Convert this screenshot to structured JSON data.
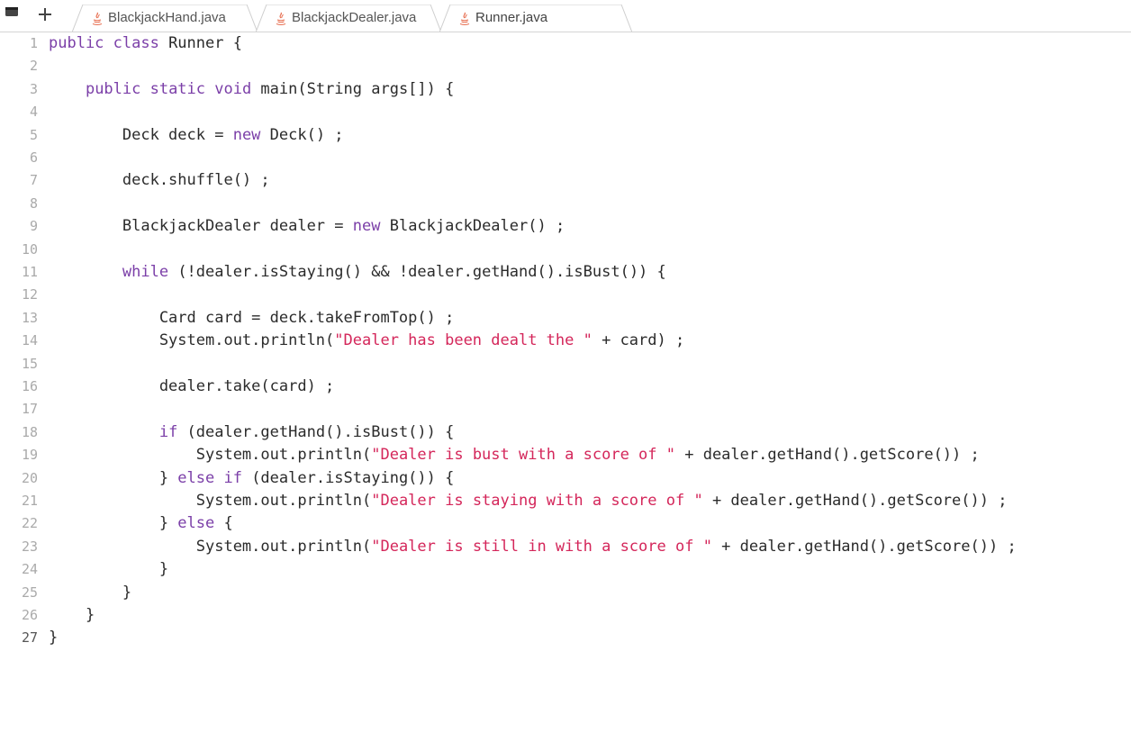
{
  "colors": {
    "keyword": "#7b3fa8",
    "string": "#d4265a",
    "plain": "#2b2b2b",
    "line_number": "#aaaaaa",
    "java_icon": "#e76f51"
  },
  "toolbar": {
    "menu_icon": "menu-icon",
    "new_tab_icon": "plus-icon"
  },
  "tabs": [
    {
      "label": "BlackjackHand.java",
      "icon": "java-icon",
      "active": false
    },
    {
      "label": "BlackjackDealer.java",
      "icon": "java-icon",
      "active": false
    },
    {
      "label": "Runner.java",
      "icon": "java-icon",
      "active": true
    }
  ],
  "editor": {
    "current_line": "27",
    "lines": [
      {
        "number": "1",
        "tokens": [
          [
            "kw",
            "public class"
          ],
          [
            "p",
            " Runner {"
          ]
        ]
      },
      {
        "number": "2",
        "tokens": []
      },
      {
        "number": "3",
        "tokens": [
          [
            "p",
            "    "
          ],
          [
            "kw",
            "public static void"
          ],
          [
            "p",
            " main(String args[]) {"
          ]
        ]
      },
      {
        "number": "4",
        "tokens": []
      },
      {
        "number": "5",
        "tokens": [
          [
            "p",
            "        Deck deck = "
          ],
          [
            "kw",
            "new"
          ],
          [
            "p",
            " Deck() ;"
          ]
        ]
      },
      {
        "number": "6",
        "tokens": []
      },
      {
        "number": "7",
        "tokens": [
          [
            "p",
            "        deck.shuffle() ;"
          ]
        ]
      },
      {
        "number": "8",
        "tokens": []
      },
      {
        "number": "9",
        "tokens": [
          [
            "p",
            "        BlackjackDealer dealer = "
          ],
          [
            "kw",
            "new"
          ],
          [
            "p",
            " BlackjackDealer() ;"
          ]
        ]
      },
      {
        "number": "10",
        "tokens": []
      },
      {
        "number": "11",
        "tokens": [
          [
            "p",
            "        "
          ],
          [
            "kw",
            "while"
          ],
          [
            "p",
            " (!dealer.isStaying() && !dealer.getHand().isBust()) {"
          ]
        ]
      },
      {
        "number": "12",
        "tokens": []
      },
      {
        "number": "13",
        "tokens": [
          [
            "p",
            "            Card card = deck.takeFromTop() ;"
          ]
        ]
      },
      {
        "number": "14",
        "tokens": [
          [
            "p",
            "            System.out.println("
          ],
          [
            "str",
            "\"Dealer has been dealt the \""
          ],
          [
            "p",
            " + card) ;"
          ]
        ]
      },
      {
        "number": "15",
        "tokens": []
      },
      {
        "number": "16",
        "tokens": [
          [
            "p",
            "            dealer.take(card) ;"
          ]
        ]
      },
      {
        "number": "17",
        "tokens": []
      },
      {
        "number": "18",
        "tokens": [
          [
            "p",
            "            "
          ],
          [
            "kw",
            "if"
          ],
          [
            "p",
            " (dealer.getHand().isBust()) {"
          ]
        ]
      },
      {
        "number": "19",
        "tokens": [
          [
            "p",
            "                System.out.println("
          ],
          [
            "str",
            "\"Dealer is bust with a score of \""
          ],
          [
            "p",
            " + dealer.getHand().getScore()) ;"
          ]
        ]
      },
      {
        "number": "20",
        "tokens": [
          [
            "p",
            "            } "
          ],
          [
            "kw",
            "else if"
          ],
          [
            "p",
            " (dealer.isStaying()) {"
          ]
        ]
      },
      {
        "number": "21",
        "tokens": [
          [
            "p",
            "                System.out.println("
          ],
          [
            "str",
            "\"Dealer is staying with a score of \""
          ],
          [
            "p",
            " + dealer.getHand().getScore()) ;"
          ]
        ]
      },
      {
        "number": "22",
        "tokens": [
          [
            "p",
            "            } "
          ],
          [
            "kw",
            "else"
          ],
          [
            "p",
            " {"
          ]
        ]
      },
      {
        "number": "23",
        "tokens": [
          [
            "p",
            "                System.out.println("
          ],
          [
            "str",
            "\"Dealer is still in with a score of \""
          ],
          [
            "p",
            " + dealer.getHand().getScore()) ;"
          ]
        ]
      },
      {
        "number": "24",
        "tokens": [
          [
            "p",
            "            }"
          ]
        ]
      },
      {
        "number": "25",
        "tokens": [
          [
            "p",
            "        }"
          ]
        ]
      },
      {
        "number": "26",
        "tokens": [
          [
            "p",
            "    }"
          ]
        ]
      },
      {
        "number": "27",
        "tokens": [
          [
            "p",
            "}"
          ]
        ]
      }
    ]
  }
}
